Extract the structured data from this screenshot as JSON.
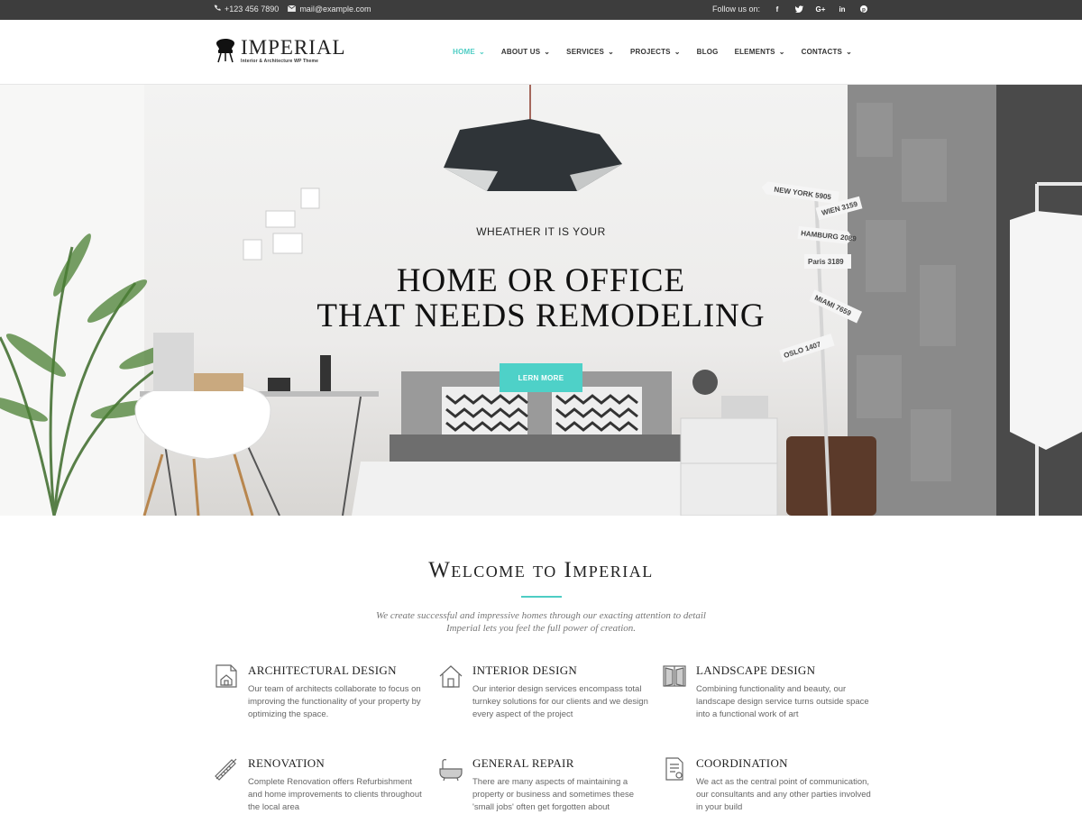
{
  "topbar": {
    "phone": "+123 456 7890",
    "email": "mail@example.com",
    "follow_label": "Follow us on:",
    "socials": [
      "facebook-icon",
      "twitter-icon",
      "google-plus-icon",
      "linkedin-icon",
      "pinterest-icon"
    ]
  },
  "logo": {
    "title": "IMPERIAL",
    "subtitle": "Interior & Architecture WP Theme"
  },
  "nav": {
    "items": [
      {
        "label": "HOME",
        "dropdown": true
      },
      {
        "label": "ABOUT US",
        "dropdown": true
      },
      {
        "label": "SERVICES",
        "dropdown": true
      },
      {
        "label": "PROJECTS",
        "dropdown": true
      },
      {
        "label": "BLOG",
        "dropdown": false
      },
      {
        "label": "ELEMENTS",
        "dropdown": true
      },
      {
        "label": "CONTACTS",
        "dropdown": true
      }
    ]
  },
  "hero": {
    "kicker": "WHEATHER IT IS YOUR",
    "title_line1": "HOME OR OFFICE",
    "title_line2": "THAT NEEDS REMODELING",
    "button": "LERN MORE",
    "signs": [
      "NEW YORK 5905",
      "WIEN 3159",
      "HAMBURG 2089",
      "Paris 3189",
      "MIAMI 7659",
      "OSLO 1407"
    ]
  },
  "welcome": {
    "title": "Welcome to Imperial",
    "line1": "We create successful and impressive homes through our exacting attention to detail",
    "line2": "Imperial lets you feel the full power of creation."
  },
  "services": [
    {
      "title": "ARCHITECTURAL DESIGN",
      "icon": "blueprint-house-icon",
      "text": "Our team of architects collaborate to focus on improving the functionality of your property by optimizing the space."
    },
    {
      "title": "INTERIOR DESIGN",
      "icon": "house-outline-icon",
      "text": "Our interior design services encompass total turnkey solutions for our clients and we design every aspect of the project"
    },
    {
      "title": "LANDSCAPE DESIGN",
      "icon": "window-icon",
      "text": "Combining functionality and beauty, our landscape design service turns outside space into a functional work of art"
    },
    {
      "title": "RENOVATION",
      "icon": "ruler-pencil-icon",
      "text": "Complete Renovation offers Refurbishment and home improvements to clients throughout the local area"
    },
    {
      "title": "GENERAL REPAIR",
      "icon": "bathtub-icon",
      "text": "There are many aspects of maintaining a property or business and sometimes these 'small jobs' often get forgotten about"
    },
    {
      "title": "COORDINATION",
      "icon": "document-icon",
      "text": "We act as the central point of communication, our consultants and any other parties involved in your build"
    }
  ],
  "colors": {
    "accent": "#4ecdc4",
    "topbar": "#3d3d3d"
  }
}
